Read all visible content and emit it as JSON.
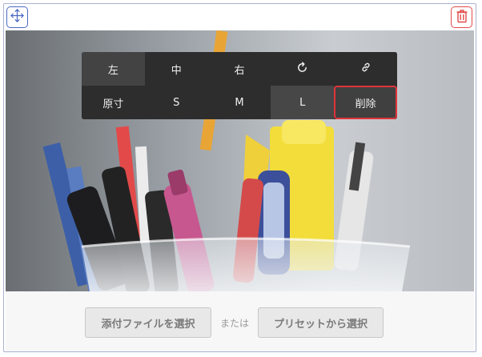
{
  "toolbar": {
    "row1": [
      {
        "label": "左",
        "name": "align-left-button"
      },
      {
        "label": "中",
        "name": "align-center-button"
      },
      {
        "label": "右",
        "name": "align-right-button"
      },
      {
        "label": "",
        "name": "rotate-button",
        "icon": "rotate-icon"
      },
      {
        "label": "",
        "name": "link-button",
        "icon": "link-icon"
      }
    ],
    "row2": [
      {
        "label": "原寸",
        "name": "size-original-button"
      },
      {
        "label": "S",
        "name": "size-s-button"
      },
      {
        "label": "M",
        "name": "size-m-button"
      },
      {
        "label": "L",
        "name": "size-l-button"
      },
      {
        "label": "削除",
        "name": "delete-image-button"
      }
    ]
  },
  "controls": {
    "move_icon": "move-icon",
    "trash_icon": "trash-icon"
  },
  "footer": {
    "attach_label": "添付ファイルを選択",
    "or_label": "または",
    "preset_label": "プリセットから選択"
  },
  "colors": {
    "move_accent": "#4a68c4",
    "trash_accent": "#e24a4a",
    "delete_highlight": "#e0343b",
    "toolbar_bg": "#2d2d2d"
  }
}
